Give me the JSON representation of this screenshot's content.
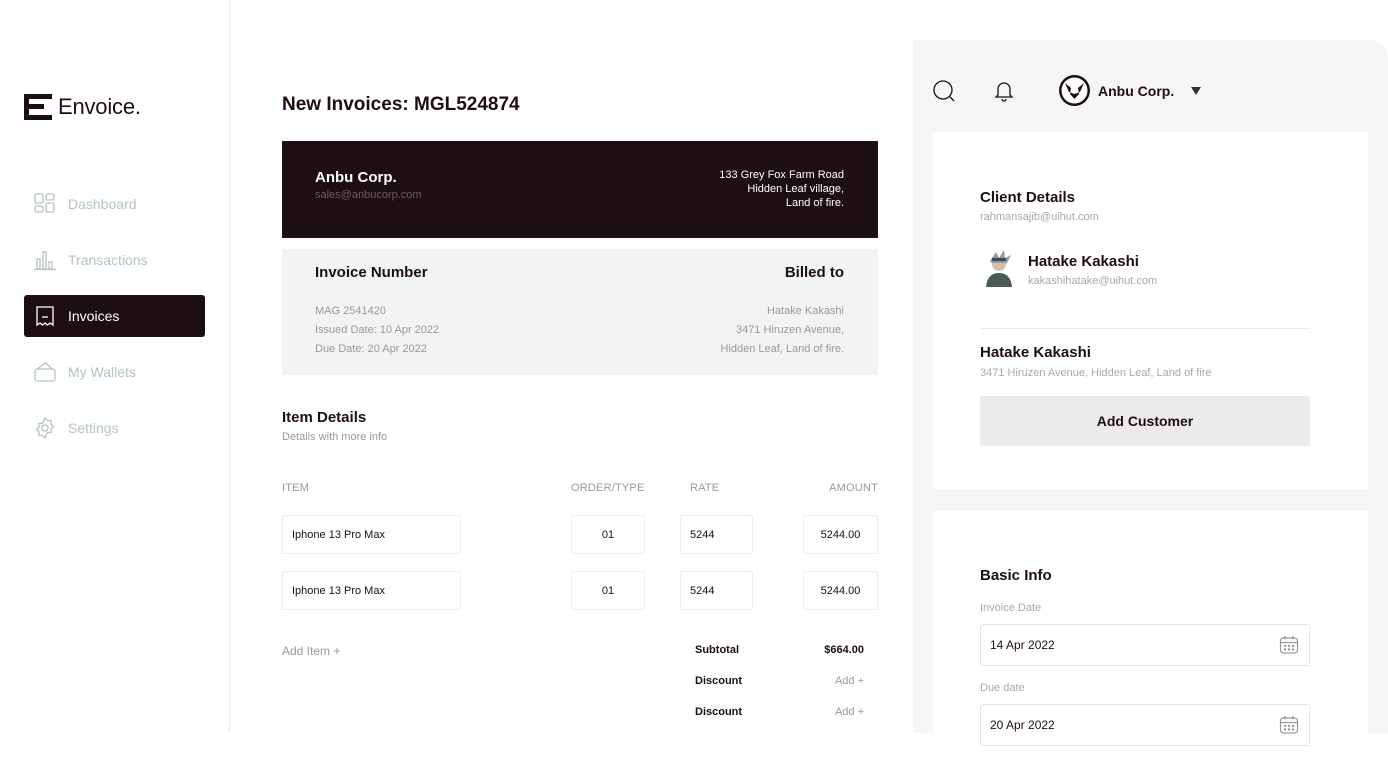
{
  "brand": {
    "name": "Envoice."
  },
  "sidebar": {
    "items": [
      {
        "label": "Dashboard",
        "icon": "dashboard-icon",
        "active": false
      },
      {
        "label": "Transactions",
        "icon": "bar-chart-icon",
        "active": false
      },
      {
        "label": "Invoices",
        "icon": "invoice-icon",
        "active": true
      },
      {
        "label": "My Wallets",
        "icon": "wallet-icon",
        "active": false
      },
      {
        "label": "Settings",
        "icon": "settings-icon",
        "active": false
      }
    ]
  },
  "main": {
    "title": "New Invoices: MGL524874",
    "company": {
      "name": "Anbu Corp.",
      "email": "sales@anbucorp.com",
      "address": [
        "133 Grey Fox Farm Road",
        "Hidden Leaf village,",
        "Land of fire."
      ]
    },
    "invoice": {
      "number_heading": "Invoice Number",
      "number": "MAG 2541420",
      "issued": "Issued Date: 10 Apr 2022",
      "due": "Due Date: 20 Apr 2022",
      "billed_heading": "Billed to",
      "billed_name": "Hatake Kakashi",
      "billed_address_1": "3471 Hiruzen Avenue,",
      "billed_address_2": "Hidden Leaf, Land of fire."
    },
    "items_section": {
      "title": "Item Details",
      "subtitle": "Details with more info",
      "columns": [
        "ITEM",
        "ORDER/TYPE",
        "RATE",
        "AMOUNT"
      ],
      "rows": [
        {
          "item": "Iphone 13 Pro Max",
          "order": "01",
          "rate": "5244",
          "amount": "5244.00"
        },
        {
          "item": "Iphone 13 Pro Max",
          "order": "01",
          "rate": "5244",
          "amount": "5244.00"
        }
      ],
      "add_item": "Add Item +"
    },
    "totals": {
      "subtotal_label": "Subtotal",
      "subtotal_value": "$664.00",
      "discount_label": "Discount",
      "discount_action": "Add +",
      "discount2_label": "Discount",
      "discount2_action": "Add +"
    }
  },
  "topbar": {
    "user_name": "Anbu Corp."
  },
  "client": {
    "title": "Client Details",
    "email": "rahmansajib@uihut.com",
    "contact_name": "Hatake Kakashi",
    "contact_email": "kakashihatake@uihut.com",
    "customer_name": "Hatake Kakashi",
    "customer_address": "3471 Hiruzen Avenue, Hidden Leaf, Land of fire",
    "add_button": "Add Customer"
  },
  "basic_info": {
    "title": "Basic Info",
    "invoice_date_label": "Invoice Date",
    "invoice_date": "14 Apr 2022",
    "due_date_label": "Due date",
    "due_date": "20 Apr 2022"
  }
}
